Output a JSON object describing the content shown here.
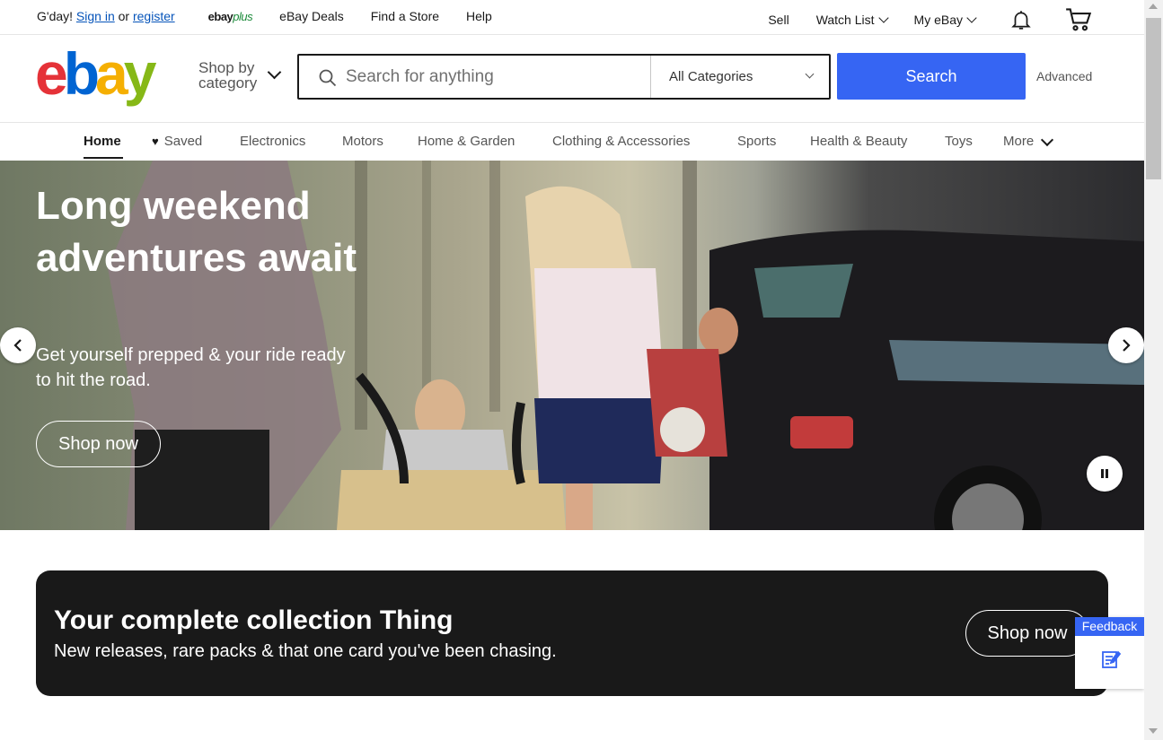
{
  "topbar": {
    "greeting": "G'day!",
    "sign_in": "Sign in",
    "or": "or",
    "register": "register",
    "ebay_plus_brand": "ebay",
    "ebay_plus_suffix": "plus",
    "deals": "eBay Deals",
    "find_store": "Find a Store",
    "help": "Help",
    "sell": "Sell",
    "watch_list": "Watch List",
    "my_ebay": "My eBay",
    "notification_icon": "bell-icon",
    "cart_icon": "cart-icon"
  },
  "header": {
    "logo": {
      "e": "e",
      "b": "b",
      "a": "a",
      "y": "y"
    },
    "shop_by_category_line1": "Shop by",
    "shop_by_category_line2": "category",
    "search_placeholder": "Search for anything",
    "category_selected": "All Categories",
    "search_button": "Search",
    "advanced": "Advanced"
  },
  "nav": {
    "tabs": [
      {
        "label": "Home",
        "active": true
      },
      {
        "label": "Saved"
      },
      {
        "label": "Electronics"
      },
      {
        "label": "Motors"
      },
      {
        "label": "Home & Garden"
      },
      {
        "label": "Clothing & Accessories"
      },
      {
        "label": "Sports"
      },
      {
        "label": "Health & Beauty"
      },
      {
        "label": "Toys"
      },
      {
        "label": "More"
      }
    ]
  },
  "hero": {
    "title": "Long weekend adventures await",
    "subtitle": "Get yourself prepped & your ride ready to hit the road.",
    "cta": "Shop now"
  },
  "banner": {
    "title": "Your complete collection Thing",
    "subtitle": "New releases, rare packs & that one card you've been chasing.",
    "cta": "Shop now"
  },
  "feedback": {
    "label": "Feedback"
  },
  "colors": {
    "accent": "#3665f3",
    "link": "#0654ba",
    "logo_red": "#e53238",
    "logo_blue": "#0064d2",
    "logo_yellow": "#f5af02",
    "logo_green": "#86b817",
    "banner_bg": "#191919"
  }
}
